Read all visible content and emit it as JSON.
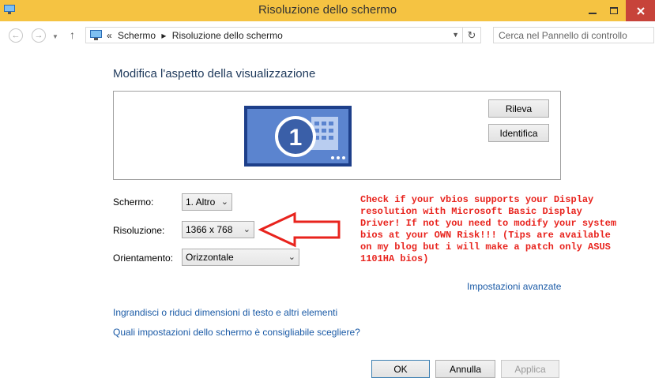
{
  "window": {
    "title": "Risoluzione dello schermo",
    "titlebar_color": "#f5c342",
    "close_color": "#c7433a"
  },
  "address": {
    "prefix": "«",
    "crumbs": [
      "Schermo",
      "Risoluzione dello schermo"
    ],
    "separator": "▸"
  },
  "search": {
    "placeholder": "Cerca nel Pannello di controllo"
  },
  "main": {
    "heading": "Modifica l'aspetto della visualizzazione",
    "monitor_number": "1",
    "rileva_label": "Rileva",
    "identifica_label": "Identifica",
    "schermo_label": "Schermo:",
    "schermo_value": "1. Altro",
    "risoluzione_label": "Risoluzione:",
    "risoluzione_value": "1366 x 768",
    "orientamento_label": "Orientamento:",
    "orientamento_value": "Orizzontale",
    "annotation_text": "Check if your vbios supports your Display\nresolution with Microsoft Basic Display\nDriver! If not you need to modify your system\nbios at your OWN Risk!!! (Tips are available\non my blog but i will make a patch only ASUS\n1101HA bios)",
    "annotation_color": "#e8231d",
    "advanced_link": "Impostazioni avanzate",
    "link_text_size": "Ingrandisci o riduci dimensioni di testo e altri elementi",
    "link_settings": "Quali impostazioni dello schermo è consigliabile scegliere?"
  },
  "footer": {
    "ok_label": "OK",
    "annulla_label": "Annulla",
    "applica_label": "Applica"
  },
  "icons": [
    "control-panel-icon",
    "minimize-icon",
    "maximize-icon",
    "close-icon",
    "back-arrow-icon",
    "forward-arrow-icon",
    "up-arrow-icon",
    "refresh-icon",
    "search-icon",
    "chevron-down-icon",
    "red-arrow-icon"
  ]
}
